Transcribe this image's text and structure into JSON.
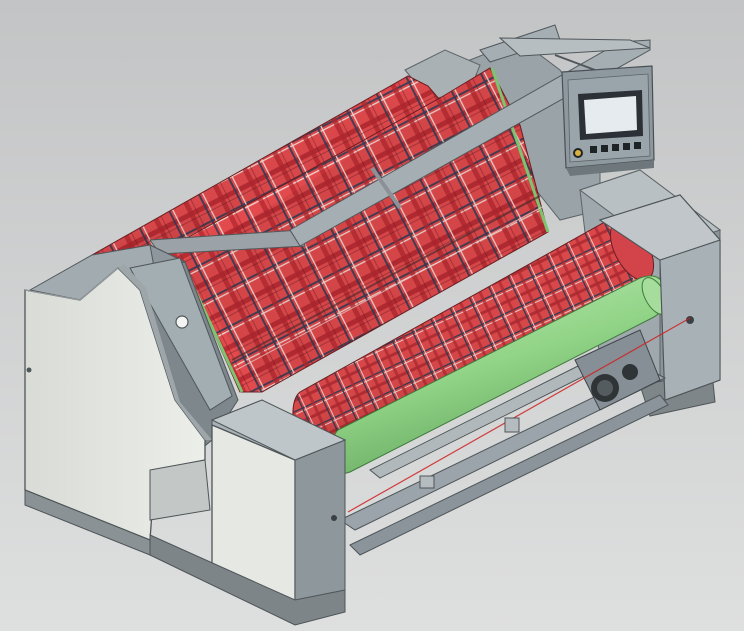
{
  "scene": {
    "subject": "",
    "colors": {
      "background_top": "#c4c5c6",
      "background_bottom": "#dcdddd",
      "frame_light": "#e4e6e2",
      "frame_mid": "#bcc0c0",
      "frame_dark": "#848a8c",
      "metal_blue_grey": "#99a6ad",
      "steel": "#9ea4a8",
      "fabric_red": "#e2454a",
      "fabric_dark": "#7a1e24",
      "plaid_dark_line": "#3a3d55",
      "plaid_light_line": "#f0d9d4",
      "roller_green": "#8fd28a",
      "roller_green_dark": "#5aa35a",
      "screen": "#e6ebef",
      "laser": "#d02020"
    },
    "icons": {
      "control_panel": "touch-screen-panel-icon",
      "buttons": "push-button-icon",
      "mount_hole": "bolt-hole-icon"
    },
    "control_panel": {
      "button_count": 6
    }
  }
}
